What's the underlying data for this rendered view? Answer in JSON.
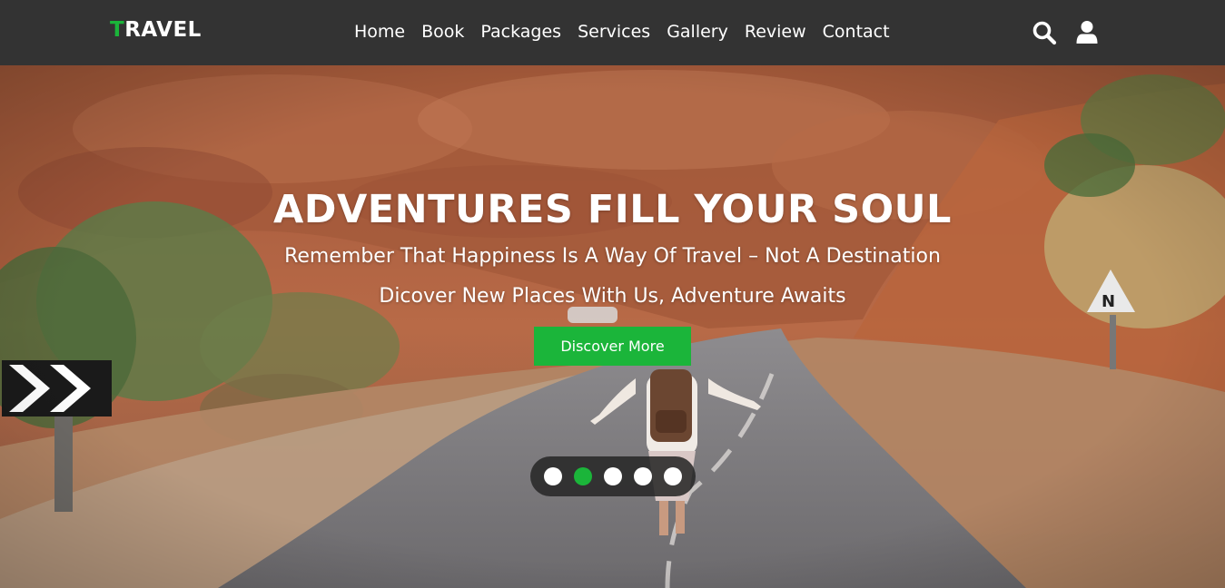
{
  "brand": {
    "logo_first": "T",
    "logo_rest": "RAVEL",
    "accent_color": "#1bb53a",
    "nav_background": "#333333"
  },
  "nav": {
    "links": [
      "Home",
      "Book",
      "Packages",
      "Services",
      "Gallery",
      "Review",
      "Contact"
    ],
    "icons": [
      "search-icon",
      "user-icon"
    ]
  },
  "hero": {
    "title": "ADVENTURES FILL YOUR SOUL",
    "subtitle_1": "Remember That Happiness Is A Way Of Travel – Not A Destination",
    "subtitle_2": "Dicover New Places With Us, Adventure Awaits",
    "cta_label": "Discover More",
    "image": "photo-of-traveler-with-backpack-walking-on-canyon-road",
    "slider": {
      "slide_count": 5,
      "active_index": 1
    }
  }
}
